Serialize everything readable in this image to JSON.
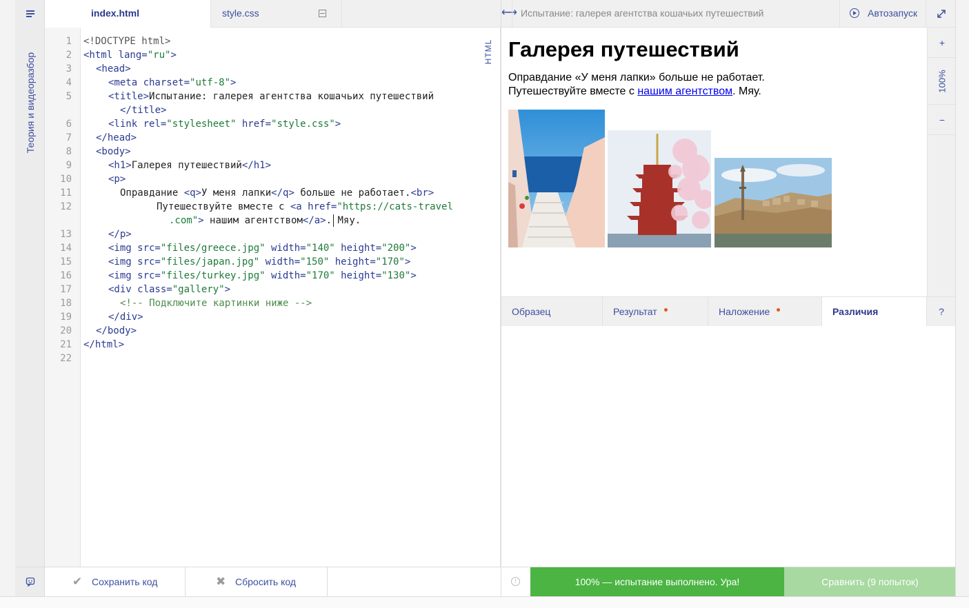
{
  "sidebar": {
    "theory_label": "Теория и видеоразбор"
  },
  "editor": {
    "tabs": [
      {
        "label": "index.html"
      },
      {
        "label": "style.css"
      }
    ],
    "language_label": "HTML",
    "line_numbers": [
      "1",
      "2",
      "3",
      "4",
      "5",
      "6",
      "7",
      "8",
      "9",
      "10",
      "11",
      "12",
      "13",
      "14",
      "15",
      "16",
      "17",
      "18",
      "19",
      "20",
      "21",
      "22"
    ],
    "code": {
      "l1_doctype": "<!DOCTYPE html>",
      "l2_tag": "<html lang=",
      "l2_val": "\"ru\"",
      "l2_end": ">",
      "l3": "<head>",
      "l4_tag": "<meta charset=",
      "l4_val": "\"utf-8\"",
      "l4_end": ">",
      "l5_tag": "<title>",
      "l5_text": "Испытание: галерея агентства кошачьих путешествий",
      "l5b_end": "</title>",
      "l6_tag": "<link rel=",
      "l6_val1": "\"stylesheet\"",
      "l6_attr2": " href=",
      "l6_val2": "\"style.css\"",
      "l6_end": ">",
      "l7": "</head>",
      "l8": "<body>",
      "l9_open": "<h1>",
      "l9_text": "Галерея путешествий",
      "l9_close": "</h1>",
      "l10": "<p>",
      "l11_text1": "Оправдание ",
      "l11_q": "<q>",
      "l11_text2": "У меня лапки",
      "l11_qc": "</q>",
      "l11_text3": " больше не работает.",
      "l11_br": "<br>",
      "l12_text": "Путешествуйте вместе с ",
      "l12_tag": "<a href=",
      "l12_val": "\"https://cats-travel",
      "l12b_val": ".com\"",
      "l12b_gt": ">",
      "l12b_text": " нашим агентством",
      "l12b_close": "</a>",
      "l12b_tail": ". Мяу.",
      "l13": "</p>",
      "img1_tag": "<img src=",
      "img1_src": "\"files/greece.jpg\"",
      "img1_w": " width=",
      "img1_wv": "\"140\"",
      "img1_h": " height=",
      "img1_hv": "\"200\"",
      "img1_end": ">",
      "img2_tag": "<img src=",
      "img2_src": "\"files/japan.jpg\"",
      "img2_w": " width=",
      "img2_wv": "\"150\"",
      "img2_h": " height=",
      "img2_hv": "\"170\"",
      "img2_end": ">",
      "img3_tag": "<img src=",
      "img3_src": "\"files/turkey.jpg\"",
      "img3_w": " width=",
      "img3_wv": "\"170\"",
      "img3_h": " height=",
      "img3_hv": "\"130\"",
      "img3_end": ">",
      "l17_tag": "<div class=",
      "l17_val": "\"gallery\"",
      "l17_end": ">",
      "l18_comment": "<!-- Подключите картинки ниже -->",
      "l19": "</div>",
      "l20": "</body>",
      "l21": "</html>"
    },
    "footer": {
      "save_label": "Сохранить код",
      "reset_label": "Сбросить код"
    }
  },
  "preview": {
    "title": "Испытание: галерея агентства кошачьих путешествий",
    "autorun_label": "Автозапуск",
    "page": {
      "heading": "Галерея путешествий",
      "line1": "Оправдание «У меня лапки» больше не работает.",
      "line2_prefix": "Путешествуйте вместе с ",
      "link_text": "нашим агентством",
      "line2_suffix": ". Мяу."
    },
    "zoom": {
      "in": "+",
      "level": "100%",
      "out": "−"
    },
    "check_tabs": [
      {
        "label": "Образец"
      },
      {
        "label": "Результат"
      },
      {
        "label": "Наложение"
      },
      {
        "label": "Различия"
      },
      {
        "label": "?"
      }
    ],
    "status_text": "100% — испытание выполнено. Ура!",
    "compare_label": "Сравнить (9 попыток)"
  },
  "icons": {
    "menu": "menu-icon",
    "resize": "resize-horizontal-icon",
    "play": "play-circle-icon",
    "fullscreen": "fullscreen-icon",
    "check": "check-icon",
    "cross": "cross-icon",
    "info": "info-icon",
    "feedback": "feedback-icon"
  },
  "colors": {
    "accent": "#3b4fa0",
    "success": "#4bb443",
    "compare_disabled": "#a7d9a1",
    "dot": "#e05a1a"
  }
}
